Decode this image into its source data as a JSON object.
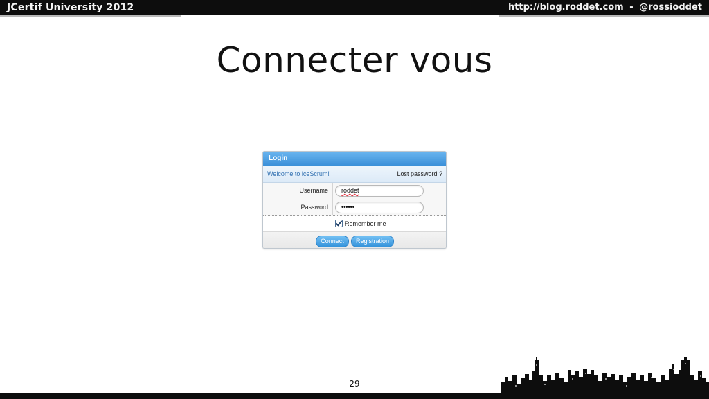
{
  "header": {
    "left_title": "JCertif University 2012",
    "blog": "http://blog.roddet.com",
    "separator": "-",
    "twitter": "@rossioddet"
  },
  "slide": {
    "title": "Connecter vous",
    "page_number": "29"
  },
  "login": {
    "title": "Login",
    "welcome": "Welcome to iceScrum!",
    "lost_password": "Lost password ?",
    "username_label": "Username",
    "username_value": "roddet",
    "password_label": "Password",
    "password_value": "••••••",
    "remember_label": "Remember me",
    "remember_checked": true,
    "connect_label": "Connect",
    "registration_label": "Registration",
    "colors": {
      "header": "#3b90d9",
      "button": "#3593db"
    }
  },
  "decorations": {
    "skyline": "city-skyline-silhouette"
  }
}
